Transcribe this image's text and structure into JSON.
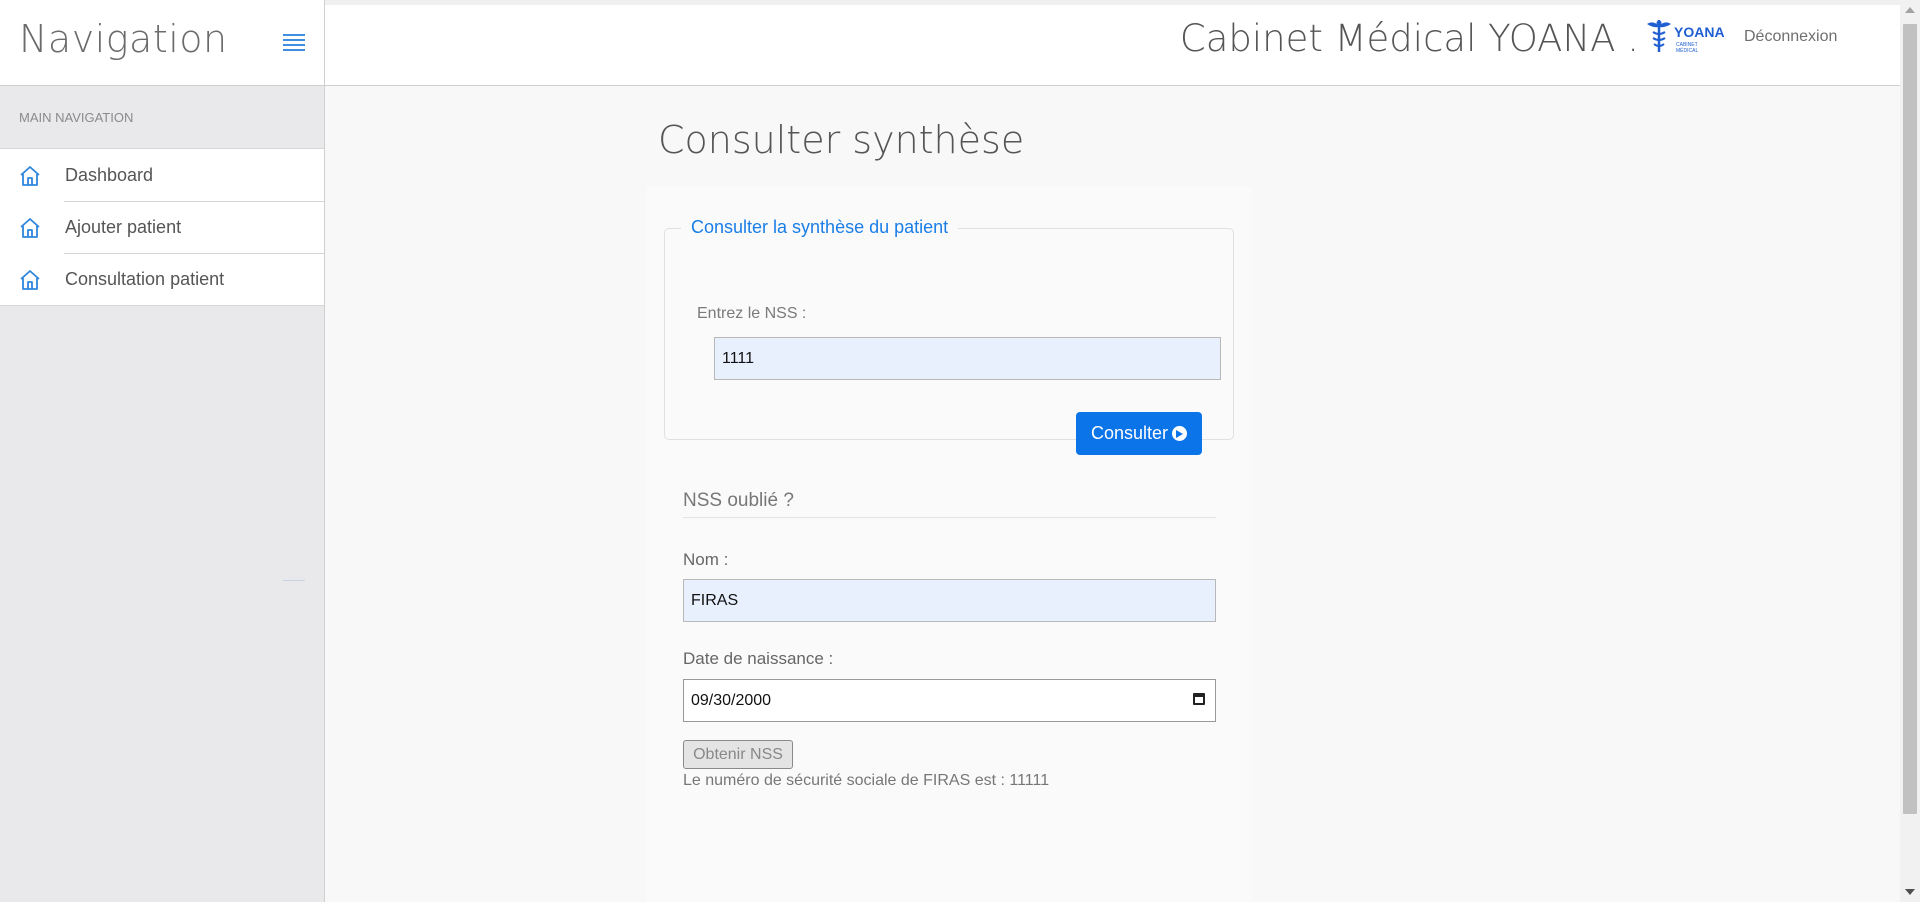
{
  "sidebar": {
    "title": "Navigation",
    "section_label": "MAIN NAVIGATION",
    "items": [
      {
        "label": "Dashboard",
        "icon": "home-icon"
      },
      {
        "label": "Ajouter patient",
        "icon": "home-icon"
      },
      {
        "label": "Consultation patient",
        "icon": "home-icon"
      }
    ]
  },
  "header": {
    "brand_title": "Cabinet Médical YOANA .",
    "logo_text": "YOANA",
    "logo_subtext": "CABINET MÉDICAL",
    "logout_label": "Déconnexion"
  },
  "main": {
    "page_title": "Consulter synthèse",
    "synthese": {
      "legend": "Consulter la synthèse du patient",
      "nss_label": "Entrez le NSS :",
      "nss_value": "1111",
      "consult_button": "Consulter"
    },
    "forgot": {
      "title": "NSS oublié ?",
      "nom_label": "Nom :",
      "nom_value": "FIRAS",
      "date_label": "Date de naissance :",
      "date_value": "09/30/2000",
      "obtain_button": "Obtenir NSS",
      "result_text": "Le numéro de sécurité sociale de FIRAS est : 11111"
    }
  },
  "colors": {
    "accent": "#0a74e8",
    "legend": "#1a7ee6",
    "sidebar_bg": "#e9e9ec",
    "autofill_bg": "#e8f0fe"
  }
}
